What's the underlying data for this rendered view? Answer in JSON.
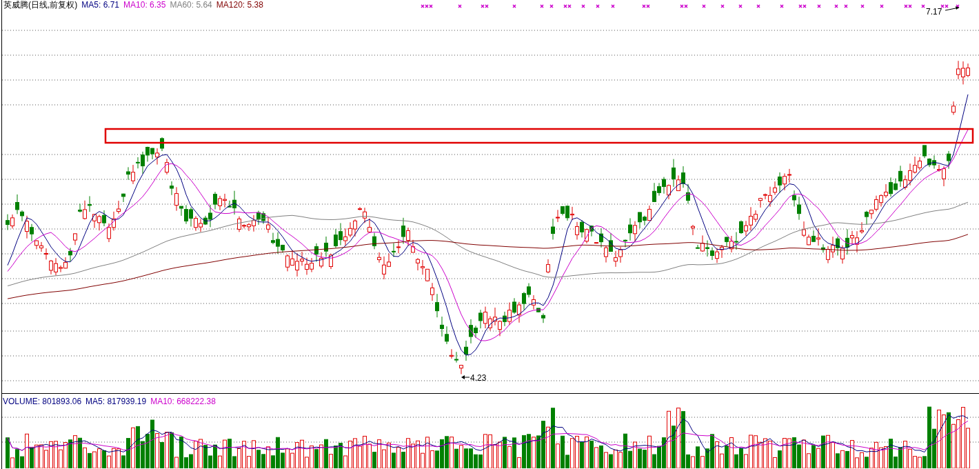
{
  "price_pane": {
    "title": "英威腾(日线,前复权)",
    "ma_readings": [
      {
        "label": "MA5: 6.71",
        "color": "#000080"
      },
      {
        "label": "MA10: 6.35",
        "color": "#cc00cc"
      },
      {
        "label": "MA60: 5.64",
        "color": "#808080"
      },
      {
        "label": "MA120: 5.38",
        "color": "#800000"
      }
    ],
    "high_label": "7.17",
    "low_label": "4.23"
  },
  "volume_pane": {
    "readings": [
      {
        "label": "VOLUME: 801893.06",
        "color": "#000080"
      },
      {
        "label": "MA5: 817939.19",
        "color": "#000080"
      },
      {
        "label": "MA10: 668222.38",
        "color": "#cc00cc"
      }
    ]
  }
}
